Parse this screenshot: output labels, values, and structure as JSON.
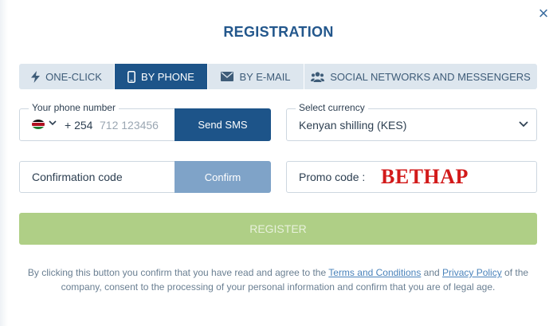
{
  "close_icon": "×",
  "title": "REGISTRATION",
  "tabs": [
    {
      "label": "ONE-CLICK",
      "icon": "lightning-icon",
      "active": false
    },
    {
      "label": "BY PHONE",
      "icon": "phone-icon",
      "active": true
    },
    {
      "label": "BY E-MAIL",
      "icon": "envelope-icon",
      "active": false
    },
    {
      "label": "SOCIAL NETWORKS AND MESSENGERS",
      "icon": "users-icon",
      "active": false
    }
  ],
  "phone": {
    "legend": "Your phone number",
    "country_code": "+ 254",
    "placeholder": "712 123456",
    "flag": "kenya-flag-icon",
    "send_label": "Send SMS"
  },
  "currency": {
    "legend": "Select currency",
    "value": "Kenyan shilling (KES)"
  },
  "confirmation": {
    "label": "Confirmation code",
    "button_label": "Confirm"
  },
  "promo": {
    "label": "Promo code :",
    "value": "BETHAP"
  },
  "register_label": "REGISTER",
  "legal": {
    "text_before": "By clicking this button you confirm that you have read and agree to the ",
    "terms_link": "Terms and Conditions",
    "text_and": " and ",
    "privacy_link": "Privacy Policy",
    "text_after": " of the company, consent to the processing of your personal information and confirm that you are of legal age."
  },
  "colors": {
    "primary": "#1d5489",
    "tab_inactive": "#dde6ee",
    "confirm_button": "#7fa3c8",
    "register_button": "#afcf86",
    "promo_text": "#d21a1a",
    "link": "#4a83bb"
  }
}
